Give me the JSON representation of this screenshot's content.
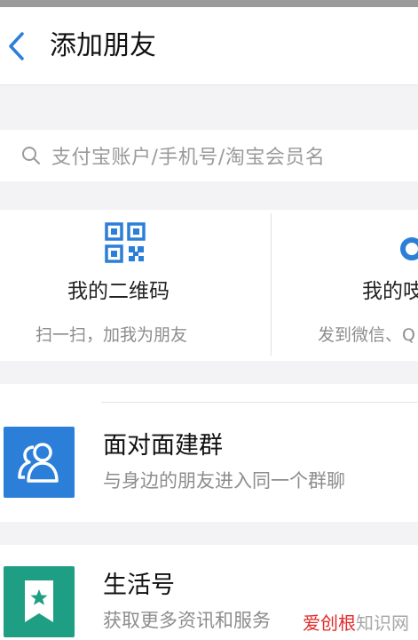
{
  "header": {
    "title": "添加朋友"
  },
  "search": {
    "placeholder": "支付宝账户/手机号/淘宝会员名"
  },
  "tiles": [
    {
      "title": "我的二维码",
      "subtitle": "扫一扫，加我为朋友"
    },
    {
      "title": "我的吱",
      "subtitle": "发到微信、Q"
    }
  ],
  "rows": [
    {
      "title": "面对面建群",
      "subtitle": "与身边的朋友进入同一个群聊"
    },
    {
      "title": "生活号",
      "subtitle": "获取更多资讯和服务"
    }
  ],
  "watermark": {
    "part1": "爱创根",
    "part2": "知识网"
  },
  "colors": {
    "accent": "#2c7fd8",
    "life_green": "#1e9e83",
    "muted_text": "#8d8d8d"
  },
  "icons": {
    "back": "chevron-left-icon",
    "search": "search-icon",
    "qr": "qr-code-icon",
    "face_group": "two-people-icon",
    "life": "bookmark-star-icon"
  }
}
